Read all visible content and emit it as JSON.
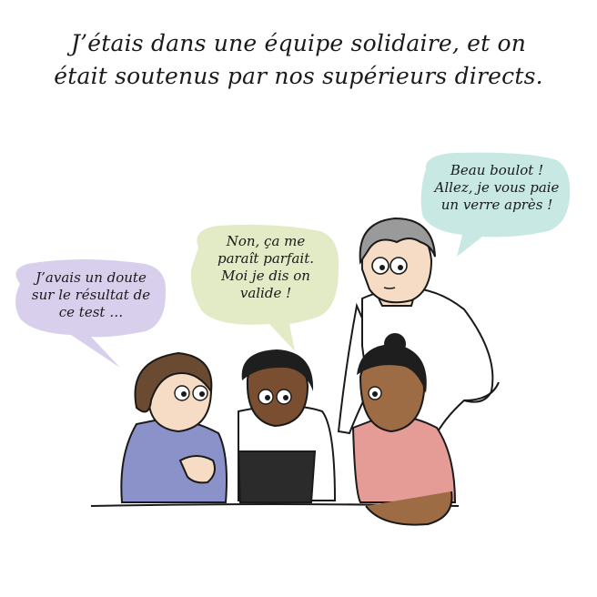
{
  "caption": {
    "line1": "J’étais dans une équipe solidaire, et on",
    "line2": "était soutenus par nos supérieurs directs."
  },
  "bubbles": {
    "left": {
      "lines": [
        "J’avais un doute",
        "sur le résultat de",
        "ce test …"
      ],
      "color": "#d8cfec"
    },
    "middle": {
      "lines": [
        "Non, ça me",
        "paraît parfait.",
        "Moi je dis on",
        "valide !"
      ],
      "color": "#e2ebc6"
    },
    "right": {
      "lines": [
        "Beau boulot !",
        "Allez, je vous paie",
        "un verre après !"
      ],
      "color": "#c7e8e3"
    }
  },
  "colors": {
    "outline": "#1a1a1a",
    "blue_shirt": "#8b92c9",
    "pink_shirt": "#e59b96",
    "white_shirt": "#ffffff",
    "laptop": "#2b2b2b",
    "skin_light": "#f6dcc4",
    "skin_dark": "#7a4f31",
    "skin_medium": "#9d6b44",
    "hair_gray": "#9a9a9a",
    "hair_brown": "#6b4a32",
    "hair_black": "#1e1e1e"
  }
}
